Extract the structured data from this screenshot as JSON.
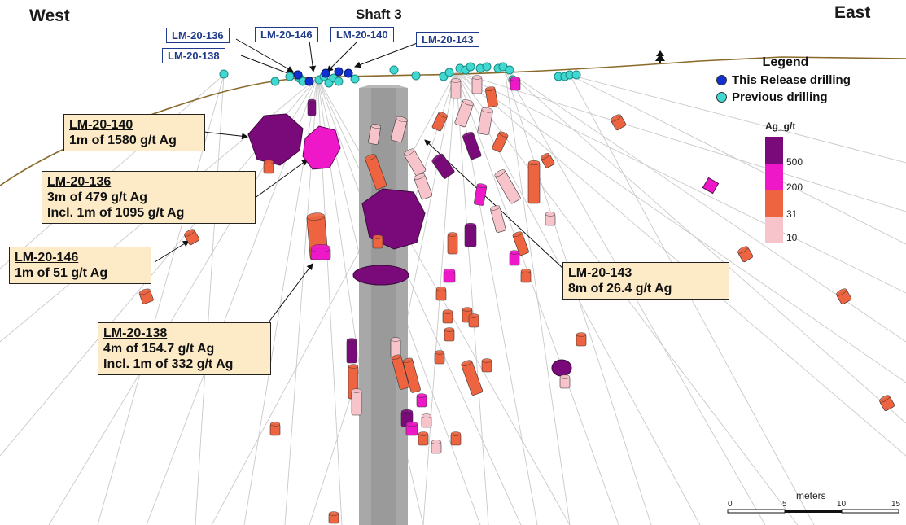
{
  "headers": {
    "west": "West",
    "east": "East",
    "shaft": "Shaft 3"
  },
  "hole_tags": [
    "LM-20-136",
    "LM-20-146",
    "LM-20-140",
    "LM-20-143",
    "LM-20-138"
  ],
  "callouts": [
    {
      "title": "LM-20-140",
      "lines": [
        "1m of 1580 g/t Ag"
      ]
    },
    {
      "title": "LM-20-136",
      "lines": [
        "3m of 479 g/t Ag",
        "Incl. 1m of 1095 g/t Ag"
      ]
    },
    {
      "title": "LM-20-146",
      "lines": [
        "1m of 51 g/t Ag"
      ]
    },
    {
      "title": "LM-20-138",
      "lines": [
        "4m of 154.7 g/t Ag",
        "Incl. 1m of 332 g/t Ag"
      ]
    },
    {
      "title": "LM-20-143",
      "lines": [
        "8m of 26.4 g/t Ag"
      ]
    }
  ],
  "legend": {
    "title": "Legend",
    "items": [
      {
        "label": "This Release drilling",
        "color": "#1030d0"
      },
      {
        "label": "Previous drilling",
        "color": "#40d8d0"
      }
    ]
  },
  "colorbar": {
    "title": "Ag_g/t",
    "levels": [
      {
        "value": "500",
        "color": "#7a0a7a"
      },
      {
        "value": "200",
        "color": "#ee18c8"
      },
      {
        "value": "31",
        "color": "#ee6440"
      },
      {
        "value": "10",
        "color": "#f7c4cc"
      }
    ]
  },
  "scale": {
    "unit": "meters",
    "ticks": [
      "0",
      "5",
      "10",
      "15"
    ]
  },
  "colors": {
    "topography": "#8a6a2a",
    "shaft": "#a8a8a8",
    "label_box": "#fdebc8",
    "tag_border": "#1f3a8a"
  }
}
